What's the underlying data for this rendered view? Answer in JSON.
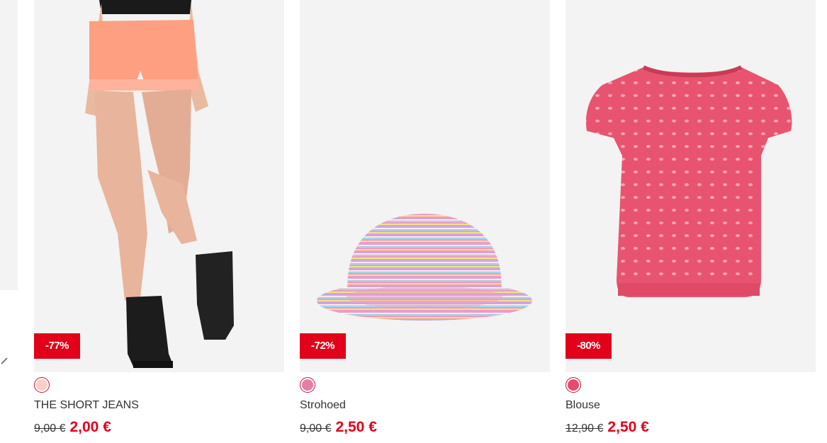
{
  "nav": {
    "prev_arrow_icon": "chevron-left-icon"
  },
  "products": [
    {
      "name": "THE SHORT JEANS",
      "badge": "-77%",
      "old_price": "9,00 €",
      "new_price": "2,00 €",
      "swatch_color": "#f9cfc6",
      "image_icon": "shorts-image"
    },
    {
      "name": "Strohoed",
      "badge": "-72%",
      "old_price": "9,00 €",
      "new_price": "2,50 €",
      "swatch_color": "#e37fa7",
      "image_icon": "striped-hat-image"
    },
    {
      "name": "Blouse",
      "badge": "-80%",
      "old_price": "12,90 €",
      "new_price": "2,50 €",
      "swatch_color": "#e24d6d",
      "image_icon": "blouse-image"
    }
  ],
  "colors": {
    "accent": "#e2001a",
    "card_bg": "#f3f3f3"
  }
}
